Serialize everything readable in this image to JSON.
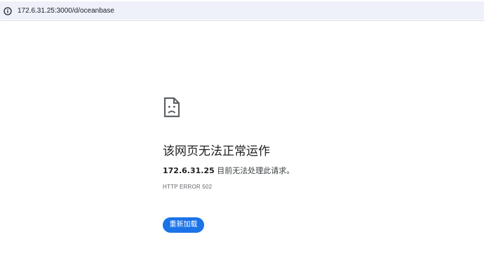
{
  "browser": {
    "url": "172.6.31.25:3000/d/oceanbase",
    "info_icon": "info-circle-icon"
  },
  "error_page": {
    "icon": "sad-page-icon",
    "title": "该网页无法正常运作",
    "host": "172.6.31.25",
    "message": " 目前无法处理此请求。",
    "error_code": "HTTP ERROR 502",
    "reload_label": "重新加载",
    "accent_color": "#1a73e8"
  }
}
